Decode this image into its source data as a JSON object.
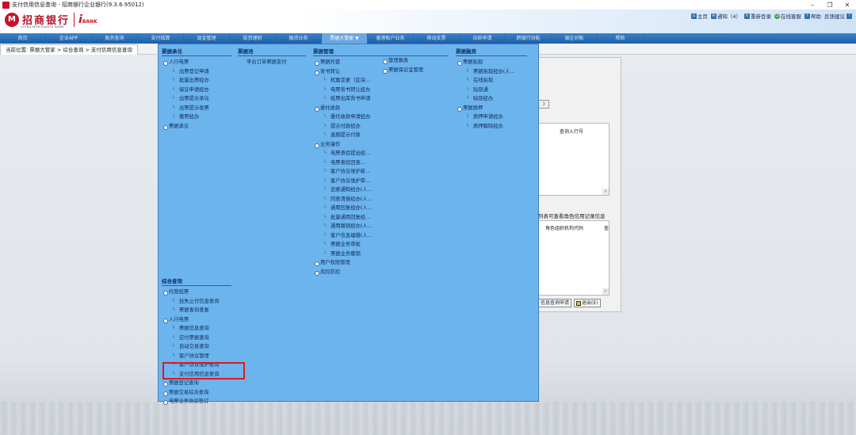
{
  "window": {
    "title": "支付信用信息查询 - 招商银行企业银行(9.3.6.95012)",
    "controls": [
      "–",
      "❐",
      "✕"
    ]
  },
  "header": {
    "logo_cn": "招商银行",
    "logo_en": "CHINA MERCHANTS BANK",
    "ibank": "i",
    "ibank_sub": "BANK",
    "links": [
      {
        "icon": "home-icon",
        "label": "主页"
      },
      {
        "icon": "notice-icon",
        "label": "通知（4）"
      },
      {
        "icon": "relogin-icon",
        "label": "重新登录"
      },
      {
        "icon": "online-service-icon",
        "label": "在线客服"
      },
      {
        "icon": "help-icon",
        "label": "帮助"
      },
      {
        "icon": "feedback-icon",
        "label": "反馈建议"
      }
    ]
  },
  "nav": {
    "items": [
      "首页",
      "企业APP",
      "账务查询",
      "支付结算",
      "现金管理",
      "投资理财",
      "融资业务",
      "票据大管家 ▼",
      "香港账户业务",
      "移动支票",
      "自助申请",
      "跨银行功能",
      "银企对账",
      "帮助"
    ],
    "active_index": 7
  },
  "breadcrumb": "当前位置: 票据大管家 > 综合查询 > 支付信用信息查询",
  "background": {
    "small_btn": ")",
    "grid1_header": "查询入行号",
    "note": "列表可查看角色信用记录信息",
    "grid2_header1": "角色组织机构代码",
    "grid2_header2": "查",
    "btn_apply": "信息查询申请",
    "btn_exit": "退出(E)",
    "scroll_arrow": "›"
  },
  "menu": {
    "col1": {
      "head": "票据承兑",
      "items": [
        {
          "lvl": 1,
          "label": "人行电票"
        },
        {
          "lvl": 2,
          "label": "出票登记申请"
        },
        {
          "lvl": 2,
          "label": "批量出票经办"
        },
        {
          "lvl": 2,
          "label": "保证申请经办"
        },
        {
          "lvl": 2,
          "label": "出票提示承兑"
        },
        {
          "lvl": 2,
          "label": "出票提示收票"
        },
        {
          "lvl": 2,
          "label": "撤票经办"
        },
        {
          "lvl": 1,
          "label": "票据承兑"
        }
      ]
    },
    "col2": {
      "head": "票据池",
      "items": [
        {
          "lvl": 2,
          "label": "平台订单票据支付"
        }
      ]
    },
    "col3": {
      "head": "票据管理",
      "items": [
        {
          "lvl": 1,
          "label": "票据托管"
        },
        {
          "lvl": 1,
          "label": "背书转让"
        },
        {
          "lvl": 2,
          "label": "权属变更（区块..."
        },
        {
          "lvl": 2,
          "label": "电票背书转让经办"
        },
        {
          "lvl": 2,
          "label": "纸票出库背书申请"
        },
        {
          "lvl": 1,
          "label": "委托收款"
        },
        {
          "lvl": 2,
          "label": "委托收款申请经办"
        },
        {
          "lvl": 2,
          "label": "提示付款经办"
        },
        {
          "lvl": 2,
          "label": "逾期提示付款"
        },
        {
          "lvl": 1,
          "label": "业务操作"
        },
        {
          "lvl": 2,
          "label": "电票查验提出经..."
        },
        {
          "lvl": 2,
          "label": "电票查验回查..."
        },
        {
          "lvl": 2,
          "label": "客户协议维护新..."
        },
        {
          "lvl": 2,
          "label": "客户协议维护审..."
        },
        {
          "lvl": 2,
          "label": "追索通知经办(人..."
        },
        {
          "lvl": 2,
          "label": "同意清偿经办(人..."
        },
        {
          "lvl": 2,
          "label": "通用回复经办(人..."
        },
        {
          "lvl": 2,
          "label": "批量通用回复经..."
        },
        {
          "lvl": 2,
          "label": "通用撤销经办(人..."
        },
        {
          "lvl": 2,
          "label": "客户信息编辑(人..."
        },
        {
          "lvl": 2,
          "label": "票据业务审批"
        },
        {
          "lvl": 2,
          "label": "票据业务撤销"
        },
        {
          "lvl": 1,
          "label": "用户权限管理"
        },
        {
          "lvl": 1,
          "label": "风险防控"
        }
      ]
    },
    "col4": {
      "items": [
        {
          "lvl": 1,
          "label": "管理报表"
        },
        {
          "lvl": 1,
          "label": "票据保证金管理"
        }
      ]
    },
    "col5": {
      "head": "票据融资",
      "items": [
        {
          "lvl": 1,
          "label": "票据贴现"
        },
        {
          "lvl": 2,
          "label": "票据贴现经办(人..."
        },
        {
          "lvl": 2,
          "label": "在线贴现"
        },
        {
          "lvl": 2,
          "label": "贴现通"
        },
        {
          "lvl": 2,
          "label": "贴现经办"
        },
        {
          "lvl": 1,
          "label": "票据质押"
        },
        {
          "lvl": 2,
          "label": "质押申请经办"
        },
        {
          "lvl": 2,
          "label": "质押解除经办"
        }
      ]
    },
    "col6": {
      "head": "综合查询",
      "items": [
        {
          "lvl": 1,
          "label": "托管纸票"
        },
        {
          "lvl": 2,
          "label": "挂失止付信息查询"
        },
        {
          "lvl": 2,
          "label": "票据查询查复"
        },
        {
          "lvl": 1,
          "label": "人行电票"
        },
        {
          "lvl": 2,
          "label": "票据信息查询"
        },
        {
          "lvl": 2,
          "label": "应付票据查询"
        },
        {
          "lvl": 2,
          "label": "自动交易查询"
        },
        {
          "lvl": 2,
          "label": "客户协议管理"
        },
        {
          "lvl": 2,
          "label": "客户协议维护查询"
        },
        {
          "lvl": 2,
          "label": "支付信用信息查询"
        },
        {
          "lvl": 1,
          "label": "票据登记查询"
        },
        {
          "lvl": 1,
          "label": "票据交易综合查询"
        },
        {
          "lvl": 1,
          "label": "电票业务协议签订"
        }
      ]
    }
  },
  "colors": {
    "nav_bg": "#2a6fb8",
    "menu_bg": "#6cb4ee",
    "highlight": "#e0181c",
    "brand_red": "#c8102e"
  }
}
